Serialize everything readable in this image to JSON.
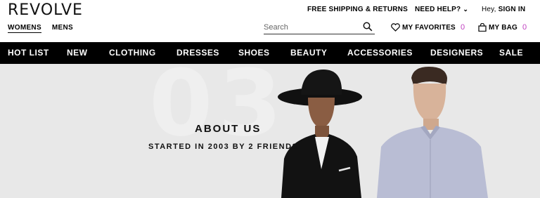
{
  "brand": {
    "logo": "REVOLVE"
  },
  "gender_tabs": [
    {
      "label": "WOMENS",
      "active": true
    },
    {
      "label": "MENS",
      "active": false
    }
  ],
  "utility": {
    "shipping": "FREE SHIPPING & RETURNS",
    "help": "NEED HELP?",
    "greeting": "Hey,",
    "signin": "SIGN IN"
  },
  "search": {
    "placeholder": "Search",
    "value": ""
  },
  "favorites": {
    "label": "MY FAVORITES",
    "count": "0"
  },
  "bag": {
    "label": "MY BAG",
    "count": "0"
  },
  "nav": [
    "HOT LIST",
    "NEW",
    "CLOTHING",
    "DRESSES",
    "SHOES",
    "BEAUTY",
    "ACCESSORIES",
    "DESIGNERS",
    "SALE"
  ],
  "hero": {
    "big_number": "03",
    "title": "ABOUT US",
    "subtitle": "STARTED IN 2003 BY 2 FRIENDS"
  },
  "colors": {
    "accent": "#c040c0",
    "nav_bg": "#000000",
    "hero_bg": "#e8e8e8"
  }
}
